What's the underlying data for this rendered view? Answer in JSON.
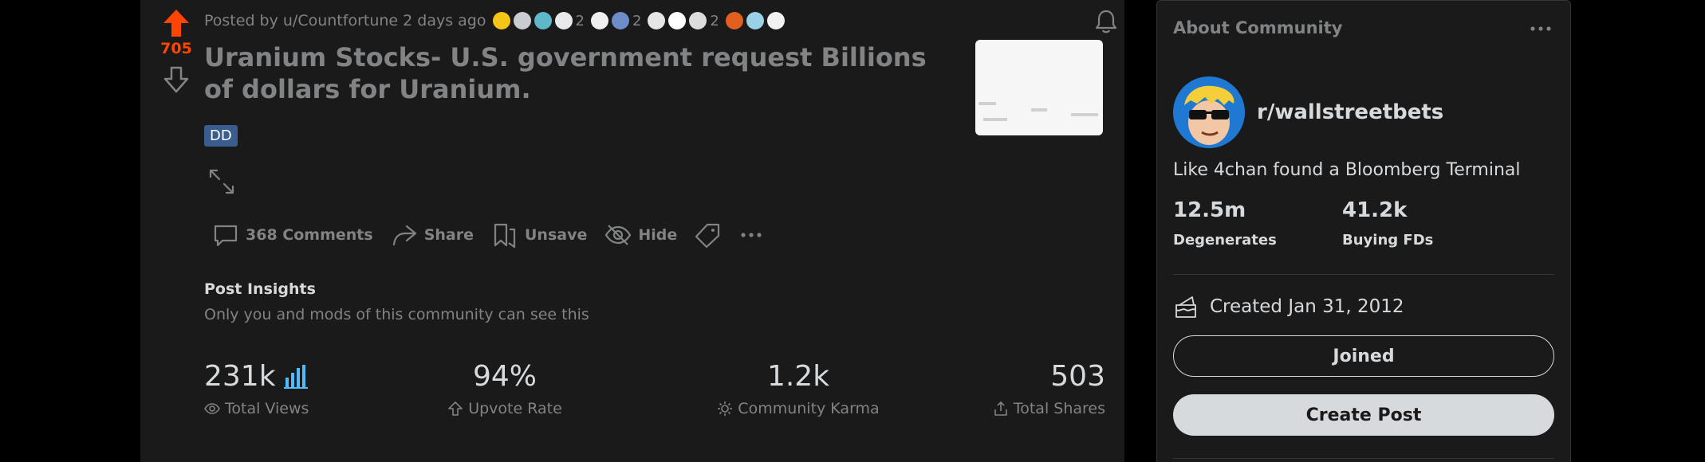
{
  "post": {
    "score": "705",
    "posted_by": "Posted by u/Countfortune 2 days ago",
    "awards": [
      {
        "icon": "gold-award-icon",
        "color": "#f5c518"
      },
      {
        "icon": "silver-award-icon",
        "color": "#c9cdd1"
      },
      {
        "icon": "wholesome-award-icon",
        "color": "#5fb8c9"
      },
      {
        "icon": "rocket-award-icon",
        "color": "#e7e9eb",
        "count": "2"
      },
      {
        "icon": "ghost-award-icon",
        "color": "#f0f0f0"
      },
      {
        "icon": "diamond-hands-award-icon",
        "color": "#6e8cc7",
        "count": "2"
      },
      {
        "icon": "cloud-award-icon",
        "color": "#e6e6e6"
      },
      {
        "icon": "cat-award-icon",
        "color": "#ffffff"
      },
      {
        "icon": "stonks-award-icon",
        "color": "#dcdcdc",
        "count": "2"
      },
      {
        "icon": "fire-award-icon",
        "color": "#e35f1f"
      },
      {
        "icon": "statue-award-icon",
        "color": "#9ad1e6"
      },
      {
        "icon": "snoo-award-icon",
        "color": "#f2f2f2"
      }
    ],
    "title": "Uranium Stocks- U.S. government request Billions of dollars for Uranium.",
    "flair": "DD",
    "actions": {
      "comments": "368 Comments",
      "share": "Share",
      "unsave": "Unsave",
      "hide": "Hide"
    },
    "insights": {
      "heading": "Post Insights",
      "subtitle": "Only you and mods of this community can see this",
      "stats": [
        {
          "value": "231k",
          "label": "Total Views",
          "icon": "eye-icon"
        },
        {
          "value": "94%",
          "label": "Upvote Rate",
          "icon": "upvote-outline-icon"
        },
        {
          "value": "1.2k",
          "label": "Community Karma",
          "icon": "karma-icon"
        },
        {
          "value": "503",
          "label": "Total Shares",
          "icon": "share-out-icon"
        }
      ]
    },
    "colors": {
      "upvote": "#ff4500",
      "flair": "#3a5d8f",
      "stats_accent": "#4fbcff"
    }
  },
  "sidebar": {
    "header": "About Community",
    "community_name": "r/wallstreetbets",
    "description": "Like 4chan found a Bloomberg Terminal",
    "members_count": "12.5m",
    "members_label": "Degenerates",
    "online_count": "41.2k",
    "online_label": "Buying FDs",
    "created": "Created Jan 31, 2012",
    "joined_label": "Joined",
    "create_post_label": "Create Post"
  }
}
